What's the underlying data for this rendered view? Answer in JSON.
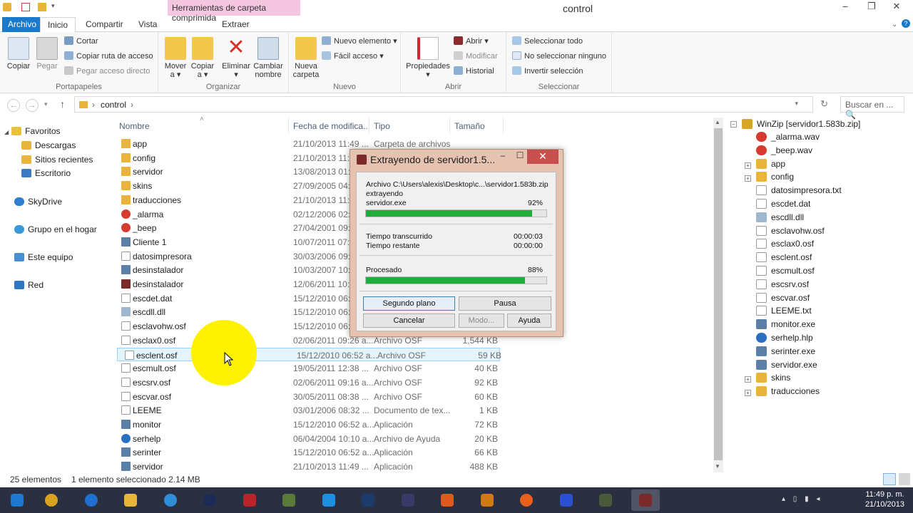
{
  "window": {
    "title": "control",
    "context_tab_title": "Herramientas de carpeta comprimida",
    "controls": [
      "–",
      "❐",
      "✕"
    ]
  },
  "ribbon_tabs": {
    "archivo": "Archivo",
    "inicio": "Inicio",
    "compartir": "Compartir",
    "vista": "Vista",
    "extraer": "Extraer"
  },
  "ribbon": {
    "portapapeles": {
      "label": "Portapapeles",
      "copiar": "Copiar",
      "pegar": "Pegar",
      "cortar": "Cortar",
      "copiar_ruta": "Copiar ruta de acceso",
      "pegar_acceso": "Pegar acceso directo"
    },
    "organizar": {
      "label": "Organizar",
      "mover": "Mover",
      "mover_a": "a ▾",
      "copiar": "Copiar",
      "copiar_a": "a ▾",
      "eliminar": "Eliminar",
      "eliminar_dd": "▾",
      "cambiar": "Cambiar",
      "nombre": "nombre"
    },
    "nuevo": {
      "label": "Nuevo",
      "nueva": "Nueva",
      "carpeta": "carpeta",
      "nuevo_elemento": "Nuevo elemento ▾",
      "facil_acceso": "Fácil acceso ▾"
    },
    "abrir": {
      "label": "Abrir",
      "propiedades": "Propiedades",
      "propiedades_dd": "▾",
      "abrir": "Abrir ▾",
      "modificar": "Modificar",
      "historial": "Historial"
    },
    "seleccionar": {
      "label": "Seleccionar",
      "todo": "Seleccionar todo",
      "ninguno": "No seleccionar ninguno",
      "invertir": "Invertir selección"
    }
  },
  "address": {
    "back": "←",
    "forward": "→",
    "recent": "▾",
    "up": "↑",
    "path_sep": "›",
    "path": "control",
    "path_sep2": "›",
    "dropdown": "▾",
    "refresh": "↻",
    "search_placeholder": "Buscar en ... 🔍"
  },
  "nav": {
    "favoritos": "Favoritos",
    "descargas": "Descargas",
    "sitios": "Sitios recientes",
    "escritorio": "Escritorio",
    "skydrive": "SkyDrive",
    "grupo": "Grupo en el hogar",
    "equipo": "Este equipo",
    "red": "Red"
  },
  "columns": {
    "sort_arrow": "˄",
    "nombre": "Nombre",
    "fecha": "Fecha de modifica...",
    "tipo": "Tipo",
    "tamano": "Tamaño"
  },
  "files": [
    {
      "name": "app",
      "date": "21/10/2013 11:49 ...",
      "type": "Carpeta de archivos",
      "size": "",
      "icon": "folder-icon"
    },
    {
      "name": "config",
      "date": "21/10/2013 11:49 ...",
      "type": "",
      "size": "",
      "icon": "folder-icon"
    },
    {
      "name": "servidor",
      "date": "13/08/2013 01:08 ...",
      "type": "",
      "size": "",
      "icon": "folder-icon"
    },
    {
      "name": "skins",
      "date": "27/09/2005 04:49 ...",
      "type": "",
      "size": "",
      "icon": "folder-icon"
    },
    {
      "name": "traducciones",
      "date": "21/10/2013 11:49 ...",
      "type": "",
      "size": "",
      "icon": "folder-icon"
    },
    {
      "name": "_alarma",
      "date": "02/12/2006 02:05 ...",
      "type": "",
      "size": "",
      "icon": "audio-icon"
    },
    {
      "name": "_beep",
      "date": "27/04/2001 09:01 ...",
      "type": "",
      "size": "",
      "icon": "audio-icon"
    },
    {
      "name": "Cliente 1",
      "date": "10/07/2011 07:06 ...",
      "type": "",
      "size": "",
      "icon": "app-icon"
    },
    {
      "name": "datosimpresora",
      "date": "30/03/2006 09:22 ...",
      "type": "",
      "size": "",
      "icon": "text-file-icon"
    },
    {
      "name": "desinstalador",
      "date": "10/03/2007 10:35 ...",
      "type": "",
      "size": "",
      "icon": "app-icon"
    },
    {
      "name": "desinstalador",
      "date": "12/06/2011 10:52 ...",
      "type": "",
      "size": "",
      "icon": "winrar-icon"
    },
    {
      "name": "escdet.dat",
      "date": "15/12/2010 06:52 ...",
      "type": "",
      "size": "",
      "icon": "file-icon"
    },
    {
      "name": "escdll.dll",
      "date": "15/12/2010 06:52 ...",
      "type": "",
      "size": "",
      "icon": "dll-icon"
    },
    {
      "name": "esclavohw.osf",
      "date": "15/12/2010 06:52 ...",
      "type": "",
      "size": "",
      "icon": "file-icon"
    },
    {
      "name": "esclax0.osf",
      "date": "02/06/2011 09:26 a...",
      "type": "Archivo OSF",
      "size": "1,544 KB",
      "icon": "file-icon"
    },
    {
      "name": "esclent.osf",
      "date": "15/12/2010 06:52 a...",
      "type": "Archivo OSF",
      "size": "59 KB",
      "icon": "file-icon",
      "selected": true
    },
    {
      "name": "escmult.osf",
      "date": "19/05/2011 12:38 ...",
      "type": "Archivo OSF",
      "size": "40 KB",
      "icon": "file-icon"
    },
    {
      "name": "escsrv.osf",
      "date": "02/06/2011 09:16 a...",
      "type": "Archivo OSF",
      "size": "92 KB",
      "icon": "file-icon"
    },
    {
      "name": "escvar.osf",
      "date": "30/05/2011 08:38 ...",
      "type": "Archivo OSF",
      "size": "60 KB",
      "icon": "file-icon"
    },
    {
      "name": "LEEME",
      "date": "03/01/2006 08:32 ...",
      "type": "Documento de tex...",
      "size": "1 KB",
      "icon": "text-file-icon"
    },
    {
      "name": "monitor",
      "date": "15/12/2010 06:52 a...",
      "type": "Aplicación",
      "size": "72 KB",
      "icon": "app-icon"
    },
    {
      "name": "serhelp",
      "date": "06/04/2004 10:10 a...",
      "type": "Archivo de Ayuda",
      "size": "20 KB",
      "icon": "help-icon"
    },
    {
      "name": "serinter",
      "date": "15/12/2010 06:52 a...",
      "type": "Aplicación",
      "size": "66 KB",
      "icon": "app-icon"
    },
    {
      "name": "servidor",
      "date": "21/10/2013 11:49 ...",
      "type": "Aplicación",
      "size": "488 KB",
      "icon": "app-icon"
    }
  ],
  "tree": {
    "root": "WinZip [servidor1.583b.zip]",
    "items": [
      {
        "label": "_alarma.wav",
        "icon": "audio-icon",
        "expandable": false
      },
      {
        "label": "_beep.wav",
        "icon": "audio-icon",
        "expandable": false
      },
      {
        "label": "app",
        "icon": "folder-icon",
        "expandable": true
      },
      {
        "label": "config",
        "icon": "folder-icon",
        "expandable": true
      },
      {
        "label": "datosimpresora.txt",
        "icon": "text-file-icon",
        "expandable": false
      },
      {
        "label": "escdet.dat",
        "icon": "file-icon",
        "expandable": false
      },
      {
        "label": "escdll.dll",
        "icon": "dll-icon",
        "expandable": false
      },
      {
        "label": "esclavohw.osf",
        "icon": "file-icon",
        "expandable": false
      },
      {
        "label": "esclax0.osf",
        "icon": "file-icon",
        "expandable": false
      },
      {
        "label": "esclent.osf",
        "icon": "file-icon",
        "expandable": false
      },
      {
        "label": "escmult.osf",
        "icon": "file-icon",
        "expandable": false
      },
      {
        "label": "escsrv.osf",
        "icon": "file-icon",
        "expandable": false
      },
      {
        "label": "escvar.osf",
        "icon": "file-icon",
        "expandable": false
      },
      {
        "label": "LEEME.txt",
        "icon": "text-file-icon",
        "expandable": false
      },
      {
        "label": "monitor.exe",
        "icon": "app-icon",
        "expandable": false
      },
      {
        "label": "serhelp.hlp",
        "icon": "help-icon",
        "expandable": false
      },
      {
        "label": "serinter.exe",
        "icon": "app-icon",
        "expandable": false
      },
      {
        "label": "servidor.exe",
        "icon": "app-icon",
        "expandable": false
      },
      {
        "label": "skins",
        "icon": "folder-icon",
        "expandable": true
      },
      {
        "label": "traducciones",
        "icon": "folder-icon",
        "expandable": true
      }
    ]
  },
  "dialog": {
    "title": "Extrayendo de servidor1.5...",
    "archive_line": "Archivo C:\\Users\\alexis\\Desktop\\c...\\servidor1.583b.zip",
    "action": "extrayendo",
    "current_file": "servidor.exe",
    "file_percent_text": "92%",
    "file_progress": 0.92,
    "elapsed_label": "Tiempo transcurrido",
    "elapsed": "00:00:03",
    "remaining_label": "Tiempo restante",
    "remaining": "00:00:00",
    "processed_label": "Procesado",
    "processed_percent_text": "88%",
    "processed_progress": 0.88,
    "btn_background": "Segundo plano",
    "btn_pause": "Pausa",
    "btn_cancel": "Cancelar",
    "btn_mode": "Modo...",
    "btn_help": "Ayuda",
    "controls": [
      "–",
      "☐",
      "✕"
    ]
  },
  "status": {
    "count": "25 elementos",
    "selection": "1 elemento seleccionado  2.14 MB"
  },
  "taskbar": {
    "time": "11:49 p. m.",
    "date": "21/10/2013",
    "apps": [
      "windows-start",
      "chrome",
      "internet-explorer",
      "file-explorer",
      "safari",
      "media-player",
      "app-red",
      "notepad-plus",
      "teamviewer",
      "photoshop",
      "camera-app",
      "start-screen",
      "fl-studio",
      "firefox",
      "app-blue",
      "app-terminal",
      "winrar"
    ]
  },
  "colors": {
    "accent": "#1979ca",
    "selection": "#e5f3fb",
    "progress": "#1fae3c",
    "dialog_frame": "#e6c2b0",
    "close_red": "#c7504f",
    "highlight": "#fff200"
  }
}
